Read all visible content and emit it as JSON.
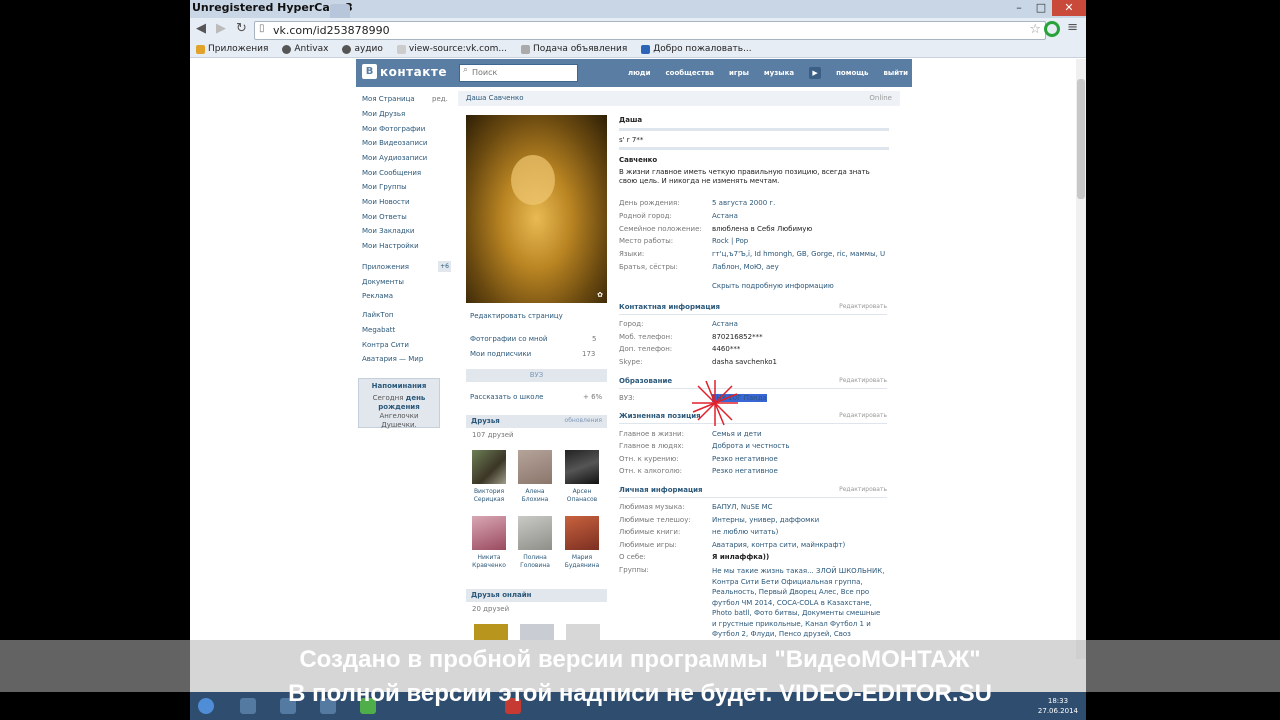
{
  "window": {
    "title": "Unregistered HyperCam 3"
  },
  "browser": {
    "url": "vk.com/id253878990",
    "bookmarks": [
      "Приложения",
      "Antivax",
      "аудио",
      "view-source:vk.com...",
      "Подача объявления",
      "Добро пожаловать..."
    ]
  },
  "vk": {
    "logo": "контакте",
    "logo_badge": "В",
    "search_placeholder": "Поиск",
    "nav": [
      "люди",
      "сообщества",
      "игры",
      "музыка",
      "помощь",
      "выйти"
    ]
  },
  "left_menu": {
    "items": [
      "Моя Страница",
      "Мои Друзья",
      "Мои Фотографии",
      "Мои Видеозаписи",
      "Мои Аудиозаписи",
      "Мои Сообщения",
      "Мои Группы",
      "Мои Новости",
      "Мои Ответы",
      "Мои Закладки",
      "Мои Настройки"
    ],
    "edit_label": "ред.",
    "apps": [
      "Приложения",
      "Документы",
      "Реклама"
    ],
    "apps_badge": "+6",
    "games": [
      "ЛайкТоп",
      "Megabatt",
      "Контра Сити",
      "Аватария — Мир"
    ],
    "reminder": {
      "title": "Напоминания",
      "line1": "Сегодня",
      "line1_bold": "день рождения",
      "line2": "Ангелочки",
      "line3": "Душечки."
    }
  },
  "profile": {
    "name": "Даша Савченко",
    "status_online": "Online",
    "edit_page": "Редактировать страницу",
    "photos_with_me": "Фотографии со мной",
    "photos_count": "5",
    "my_subscribers": "Мои подписчики",
    "subscribers_count": "173",
    "tile_label": "ВУЗ",
    "school_tell": "Рассказать о школе",
    "school_percent": "+ 6%",
    "friends": {
      "title": "Друзья",
      "right": "обновления",
      "count": "107 друзей",
      "list": [
        {
          "name1": "Виктория",
          "name2": "Серицкая"
        },
        {
          "name1": "Алена",
          "name2": "Блохина"
        },
        {
          "name1": "Арсен",
          "name2": "Опанасов"
        },
        {
          "name1": "Никита",
          "name2": "Кравченко"
        },
        {
          "name1": "Полина",
          "name2": "Головина"
        },
        {
          "name1": "Мария",
          "name2": "Будаянина"
        }
      ]
    },
    "friends_online": {
      "title": "Друзья онлайн",
      "count": "20 друзей"
    }
  },
  "info": {
    "first_name": "Даша",
    "quote": "s' r 7**",
    "last_name": "Савченко",
    "motto": "В жизни главное иметь четкую правильную позицию, всегда знать свою цель. И никогда не изменять мечтам.",
    "basic": [
      {
        "label": "День рождения:",
        "value": "5 августа 2000 г."
      },
      {
        "label": "Родной город:",
        "value": "Астана"
      },
      {
        "label": "Семейное положение:",
        "value": "влюблена в Себя Любимую"
      },
      {
        "label": "Место работы:",
        "value": "Rock | Pop"
      },
      {
        "label": "Языки:",
        "value": "гт'ц,ъ7'Ъ,ї, Id hmongh, GB, Gorge, ric, маммы, U"
      },
      {
        "label": "Братья, сёстры:",
        "value": "Лаблон, МоЮ, aey"
      }
    ],
    "hide_details": "Скрыть подробную информацию",
    "edit": "Редактировать",
    "contact": {
      "title": "Контактная информация",
      "rows": [
        {
          "label": "Город:",
          "value": "Астана"
        },
        {
          "label": "Моб. телефон:",
          "value": "870216852***"
        },
        {
          "label": "Доп. телефон:",
          "value": "4460***"
        },
        {
          "label": "Skype:",
          "value": "dasha savchenko1"
        }
      ]
    },
    "education": {
      "title": "Образование",
      "label": "ВУЗ:",
      "value": "ЕНУ 10Г Панда"
    },
    "life": {
      "title": "Жизненная позиция",
      "rows": [
        {
          "label": "Главное в жизни:",
          "value": "Семья и дети"
        },
        {
          "label": "Главное в людях:",
          "value": "Доброта и честность"
        },
        {
          "label": "Отн. к курению:",
          "value": "Резко негативное"
        },
        {
          "label": "Отн. к алкоголю:",
          "value": "Резко негативное"
        }
      ]
    },
    "personal": {
      "title": "Личная информация",
      "rows": [
        {
          "label": "Любимая музыка:",
          "value": "БАПУЛ, NuSE MC"
        },
        {
          "label": "Любимые телешоу:",
          "value": "Интерны, универ, даффомки"
        },
        {
          "label": "Любимые книги:",
          "value": "не люблю читать)"
        },
        {
          "label": "Любимые игры:",
          "value": "Аватария, контра сити, майнкрафт)"
        },
        {
          "label": "О себе:",
          "value": "Я инлаффка))"
        }
      ],
      "groups_label": "Группы:",
      "groups": [
        "Не мы такие жизнь такая... ЗЛОЙ ШКОЛЬНИК,",
        "Контра Сити Бети Официальная группа,",
        "Реальность, Первый Дворец Алес, Все про",
        "футбол ЧМ 2014, COCA-COLA в Казахстане,",
        "Photo batll, Фото битвы, Документы смешные",
        "и грустные прикольные, Канал Футбол 1 и",
        "Футбол 2, Флуди, Пенсо друзей, Своз"
      ]
    }
  },
  "watermark": {
    "line1": "Создано в пробной версии программы \"ВидеоМОНТАЖ\"",
    "line2": "В полной версии этой надписи не будет. VIDEO-EDITOR.SU"
  },
  "taskbar": {
    "time": "18:33",
    "date": "27.06.2014"
  }
}
